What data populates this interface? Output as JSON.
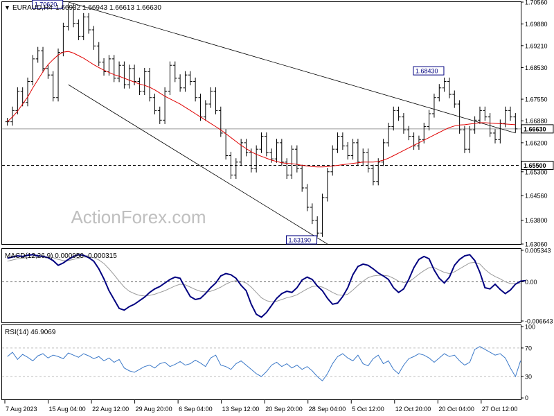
{
  "header": {
    "symbol": "EURAUD,H4",
    "ohlc": "1.66932 1.66943 1.66613 1.66630"
  },
  "watermark": "ActionForex.com",
  "colors": {
    "price": "#000000",
    "ma": "#e00000",
    "macd": "#000080",
    "signal": "#9a9a9a",
    "rsi": "#3a78c8",
    "tag_border": "#000080",
    "grid": "#000000"
  },
  "chart_data": [
    {
      "type": "line",
      "panel": "price",
      "x_labels": [
        "7 Aug 2023",
        "15 Aug 04:00",
        "22 Aug 12:00",
        "29 Aug 20:00",
        "6 Sep 04:00",
        "13 Sep 12:00",
        "20 Sep 20:00",
        "28 Sep 04:00",
        "5 Oct 12:00",
        "12 Oct 20:00",
        "20 Oct 04:00",
        "27 Oct 12:00"
      ],
      "y_ticks": [
        "1.70560",
        "1.69880",
        "1.69210",
        "1.68530",
        "1.67550",
        "1.66880",
        "1.66200",
        "1.65300",
        "1.64560",
        "1.63800",
        "1.63060"
      ],
      "ylim": [
        1.6306,
        1.7056
      ],
      "series": [
        {
          "style": "bars",
          "values": [
            1.6685,
            1.672,
            1.678,
            1.6745,
            1.681,
            1.688,
            1.6905,
            1.685,
            1.683,
            1.676,
            1.69,
            1.698,
            1.704,
            1.699,
            1.695,
            1.701,
            1.697,
            1.692,
            1.687,
            1.684,
            1.688,
            1.682,
            1.686,
            1.68,
            1.685,
            1.681,
            1.678,
            1.684,
            1.676,
            1.672,
            1.669,
            1.678,
            1.686,
            1.682,
            1.679,
            1.683,
            1.681,
            1.676,
            1.67,
            1.674,
            1.678,
            1.672,
            1.665,
            1.658,
            1.652,
            1.656,
            1.662,
            1.659,
            1.654,
            1.66,
            1.664,
            1.659,
            1.657,
            1.662,
            1.656,
            1.652,
            1.66,
            1.654,
            1.648,
            1.642,
            1.638,
            1.634,
            1.645,
            1.653,
            1.66,
            1.664,
            1.661,
            1.658,
            1.662,
            1.656,
            1.659,
            1.654,
            1.65,
            1.656,
            1.662,
            1.667,
            1.672,
            1.67,
            1.666,
            1.664,
            1.661,
            1.663,
            1.667,
            1.671,
            1.676,
            1.679,
            1.681,
            1.677,
            1.674,
            1.666,
            1.66,
            1.666,
            1.669,
            1.672,
            1.67,
            1.665,
            1.663,
            1.668,
            1.672,
            1.67,
            1.6663
          ]
        },
        {
          "name": "",
          "style": "ma",
          "values": [
            1.6685,
            1.67,
            1.6718,
            1.674,
            1.6762,
            1.679,
            1.6815,
            1.684,
            1.6862,
            1.6878,
            1.6892,
            1.6901,
            1.6903,
            1.6898,
            1.689,
            1.6882,
            1.6872,
            1.6862,
            1.6853,
            1.6845,
            1.6838,
            1.6831,
            1.6826,
            1.682,
            1.6814,
            1.6808,
            1.6802,
            1.6798,
            1.6792,
            1.6784,
            1.6774,
            1.6764,
            1.6756,
            1.6748,
            1.674,
            1.673,
            1.672,
            1.671,
            1.67,
            1.669,
            1.668,
            1.667,
            1.666,
            1.6648,
            1.6636,
            1.6624,
            1.6612,
            1.6602,
            1.6592,
            1.6584,
            1.6578,
            1.6572,
            1.6566,
            1.6562,
            1.6558,
            1.6556,
            1.6555,
            1.6553,
            1.655,
            1.6548,
            1.6546,
            1.6545,
            1.6545,
            1.6546,
            1.6548,
            1.655,
            1.6552,
            1.6554,
            1.6556,
            1.6558,
            1.656,
            1.656,
            1.656,
            1.6562,
            1.6566,
            1.6572,
            1.658,
            1.6588,
            1.6596,
            1.6604,
            1.6612,
            1.662,
            1.6628,
            1.6636,
            1.6644,
            1.6652,
            1.666,
            1.6667,
            1.6672,
            1.6675,
            1.6676,
            1.6678,
            1.668,
            1.6682,
            1.6682,
            1.6681,
            1.668,
            1.6679,
            1.6678,
            1.6677,
            1.6676
          ]
        }
      ],
      "trend_lines": [
        {
          "from": [
            1.7056,
            12
          ],
          "to": [
            1.665,
            100
          ]
        },
        {
          "from": [
            1.68,
            12
          ],
          "to": [
            1.6306,
            63
          ]
        }
      ],
      "levels": [
        {
          "label": "1.65500",
          "value": 1.655,
          "style": "dashed"
        },
        {
          "label": "1.66630",
          "value": 1.6663,
          "style": "solid-gray"
        }
      ],
      "annotations": [
        {
          "label": "1.70620",
          "value": 1.7062,
          "bar": 12
        },
        {
          "label": "1.63190",
          "value": 1.6319,
          "bar": 62
        },
        {
          "label": "1.68430",
          "value": 1.6843,
          "bar": 87
        }
      ]
    },
    {
      "type": "line",
      "panel": "macd",
      "title": "MACD(12,26,9) 0.000950 -0.000315",
      "y_ticks": [
        "0.005343",
        "0.00",
        "-0.006643"
      ],
      "ylim": [
        -0.006643,
        0.005343
      ],
      "series": [
        {
          "style": "macd",
          "values": [
            0.004,
            0.0042,
            0.0044,
            0.0043,
            0.0045,
            0.0046,
            0.0044,
            0.0043,
            0.0041,
            0.0036,
            0.0028,
            0.0032,
            0.0038,
            0.0043,
            0.0046,
            0.0045,
            0.0041,
            0.0035,
            0.0022,
            0.0005,
            -0.0015,
            -0.003,
            -0.0045,
            -0.0048,
            -0.0042,
            -0.0038,
            -0.0032,
            -0.0026,
            -0.0018,
            -0.0012,
            -0.0008,
            -0.0002,
            0.0004,
            0.0008,
            0.0006,
            -0.001,
            -0.0025,
            -0.003,
            -0.0028,
            -0.002,
            -0.001,
            -0.0002,
            0.001,
            0.0014,
            0.0012,
            0.0006,
            -0.0006,
            -0.0015,
            -0.0038,
            -0.0055,
            -0.006,
            -0.0052,
            -0.004,
            -0.0028,
            -0.002,
            -0.0016,
            -0.0018,
            -0.001,
            0.0003,
            0.0008,
            0.0004,
            -0.0007,
            -0.0015,
            -0.0028,
            -0.0038,
            -0.0036,
            -0.0025,
            -0.001,
            0.0012,
            0.0026,
            0.003,
            0.0028,
            0.0022,
            0.0015,
            0.001,
            0.0004,
            -0.001,
            -0.0018,
            -0.0012,
            0.0004,
            0.0024,
            0.0038,
            0.0043,
            0.0039,
            0.002,
            0.0006,
            -0.0002,
            0.0008,
            0.0028,
            0.0038,
            0.0044,
            0.0046,
            0.0036,
            0.0016,
            -0.001,
            -0.0012,
            -0.0004,
            -0.0013,
            -0.002,
            -0.0014,
            -0.0004,
            0.0001,
            0.0002
          ]
        },
        {
          "style": "signal",
          "values": [
            0.0035,
            0.0037,
            0.0039,
            0.004,
            0.0041,
            0.0042,
            0.0043,
            0.0043,
            0.0042,
            0.0041,
            0.0038,
            0.0036,
            0.0036,
            0.0038,
            0.004,
            0.0042,
            0.0042,
            0.0041,
            0.0037,
            0.0031,
            0.0022,
            0.0012,
            0.0001,
            -0.0009,
            -0.0016,
            -0.002,
            -0.0023,
            -0.0024,
            -0.0023,
            -0.0021,
            -0.0018,
            -0.0015,
            -0.0011,
            -0.0007,
            -0.0004,
            -0.0005,
            -0.0009,
            -0.0013,
            -0.0016,
            -0.0017,
            -0.0016,
            -0.0013,
            -0.0009,
            -0.0004,
            0.0,
            0.0002,
            0.0001,
            -0.0002,
            -0.0009,
            -0.0018,
            -0.0027,
            -0.0032,
            -0.0034,
            -0.0033,
            -0.003,
            -0.0027,
            -0.0025,
            -0.0022,
            -0.0017,
            -0.0012,
            -0.0008,
            -0.0007,
            -0.0009,
            -0.0013,
            -0.0018,
            -0.0022,
            -0.0023,
            -0.0021,
            -0.0014,
            -0.0006,
            0.0001,
            0.0007,
            0.001,
            0.0011,
            0.0011,
            0.001,
            0.0006,
            0.0001,
            -0.0001,
            0.0,
            0.0006,
            0.0013,
            0.0019,
            0.0024,
            0.0024,
            0.002,
            0.0016,
            0.0014,
            0.0017,
            0.0022,
            0.0027,
            0.0032,
            0.0033,
            0.003,
            0.0021,
            0.0014,
            0.0009,
            0.0005,
            0.0,
            -0.0003,
            -0.0003,
            -0.0002
          ]
        }
      ]
    },
    {
      "type": "line",
      "panel": "rsi",
      "title": "RSI(14) 46.9069",
      "y_ticks": [
        "100",
        "70",
        "30",
        "0"
      ],
      "ylim": [
        0,
        100
      ],
      "levels": [
        70,
        30
      ],
      "series": [
        {
          "style": "rsi",
          "values": [
            58,
            64,
            54,
            61,
            57,
            52,
            59,
            62,
            56,
            60,
            58,
            55,
            63,
            60,
            57,
            62,
            59,
            55,
            58,
            52,
            56,
            50,
            54,
            42,
            38,
            36,
            40,
            44,
            46,
            42,
            48,
            50,
            44,
            47,
            51,
            46,
            48,
            53,
            49,
            44,
            56,
            60,
            46,
            44,
            40,
            48,
            52,
            46,
            40,
            34,
            30,
            37,
            46,
            50,
            44,
            48,
            42,
            46,
            40,
            44,
            38,
            30,
            24,
            34,
            48,
            58,
            62,
            56,
            52,
            60,
            48,
            45,
            55,
            60,
            48,
            52,
            40,
            34,
            46,
            55,
            58,
            62,
            60,
            56,
            50,
            56,
            62,
            58,
            60,
            52,
            46,
            50,
            68,
            72,
            68,
            64,
            60,
            62,
            56,
            42,
            30,
            52
          ]
        }
      ]
    }
  ]
}
